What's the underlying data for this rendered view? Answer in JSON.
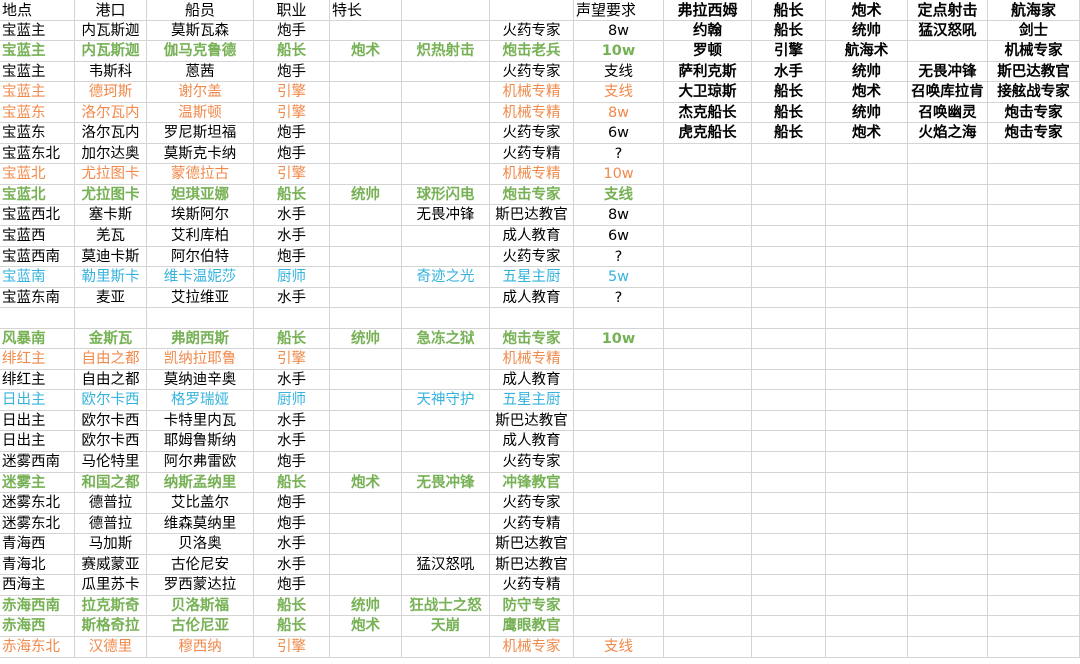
{
  "colors": {
    "green": "#77b155",
    "orange": "#f08a4b",
    "cyan": "#35b3dd",
    "grid": "#d4d4d4"
  },
  "header": [
    "地点",
    "港口",
    "船员",
    "职业",
    "特长",
    "",
    "",
    "声望要求"
  ],
  "rows": [
    {
      "style": "",
      "cells": [
        "宝蓝主",
        "内瓦斯迦",
        "莫斯瓦森",
        "炮手",
        "",
        "",
        "火药专家",
        "8w"
      ]
    },
    {
      "style": "green",
      "cells": [
        "宝蓝主",
        "内瓦斯迦",
        "伽马克鲁德",
        "船长",
        "炮术",
        "炽热射击",
        "炮击老兵",
        "10w"
      ]
    },
    {
      "style": "",
      "cells": [
        "宝蓝主",
        "韦斯科",
        "蒽茜",
        "炮手",
        "",
        "",
        "火药专家",
        "支线"
      ]
    },
    {
      "style": "orange",
      "cells": [
        "宝蓝主",
        "德珂斯",
        "谢尔盖",
        "引擎",
        "",
        "",
        "机械专精",
        "支线"
      ]
    },
    {
      "style": "orange",
      "cells": [
        "宝蓝东",
        "洛尔瓦内",
        "温斯顿",
        "引擎",
        "",
        "",
        "机械专精",
        "8w"
      ]
    },
    {
      "style": "",
      "cells": [
        "宝蓝东",
        "洛尔瓦内",
        "罗尼斯坦福",
        "炮手",
        "",
        "",
        "火药专家",
        "6w"
      ]
    },
    {
      "style": "",
      "cells": [
        "宝蓝东北",
        "加尔达奥",
        "莫斯克卡纳",
        "炮手",
        "",
        "",
        "火药专精",
        "?"
      ]
    },
    {
      "style": "orange",
      "cells": [
        "宝蓝北",
        "尤拉图卡",
        "蒙德拉古",
        "引擎",
        "",
        "",
        "机械专精",
        "10w"
      ]
    },
    {
      "style": "green",
      "cells": [
        "宝蓝北",
        "尤拉图卡",
        "妲琪亚娜",
        "船长",
        "统帅",
        "球形闪电",
        "炮击专家",
        "支线"
      ]
    },
    {
      "style": "",
      "cells": [
        "宝蓝西北",
        "塞卡斯",
        "埃斯阿尔",
        "水手",
        "",
        "无畏冲锋",
        "斯巴达教官",
        "8w"
      ]
    },
    {
      "style": "",
      "cells": [
        "宝蓝西",
        "羌瓦",
        "艾利库柏",
        "水手",
        "",
        "",
        "成人教育",
        "6w"
      ]
    },
    {
      "style": "",
      "cells": [
        "宝蓝西南",
        "莫迪卡斯",
        "阿尔伯特",
        "炮手",
        "",
        "",
        "火药专家",
        "?"
      ]
    },
    {
      "style": "cyan",
      "cells": [
        "宝蓝南",
        "勒里斯卡",
        "维卡温妮莎",
        "厨师",
        "",
        "奇迹之光",
        "五星主厨",
        "5w"
      ]
    },
    {
      "style": "",
      "cells": [
        "宝蓝东南",
        "麦亚",
        "艾拉维亚",
        "水手",
        "",
        "",
        "成人教育",
        "?"
      ]
    },
    {
      "style": "",
      "cells": [
        "",
        "",
        "",
        "",
        "",
        "",
        "",
        ""
      ]
    },
    {
      "style": "green",
      "cells": [
        "风暴南",
        "金斯瓦",
        "弗朗西斯",
        "船长",
        "统帅",
        "急冻之狱",
        "炮击专家",
        "10w"
      ]
    },
    {
      "style": "orange",
      "cells": [
        "绯红主",
        "自由之都",
        "凯纳拉耶鲁",
        "引擎",
        "",
        "",
        "机械专精",
        ""
      ]
    },
    {
      "style": "",
      "cells": [
        "绯红主",
        "自由之都",
        "莫纳迪辛奥",
        "水手",
        "",
        "",
        "成人教育",
        ""
      ]
    },
    {
      "style": "cyan",
      "cells": [
        "日出主",
        "欧尔卡西",
        "格罗瑞娅",
        "厨师",
        "",
        "天神守护",
        "五星主厨",
        ""
      ]
    },
    {
      "style": "",
      "cells": [
        "日出主",
        "欧尔卡西",
        "卡特里内瓦",
        "水手",
        "",
        "",
        "斯巴达教官",
        ""
      ]
    },
    {
      "style": "",
      "cells": [
        "日出主",
        "欧尔卡西",
        "耶姆鲁斯纳",
        "水手",
        "",
        "",
        "成人教育",
        ""
      ]
    },
    {
      "style": "",
      "cells": [
        "迷雾西南",
        "马伦特里",
        "阿尔弗雷欧",
        "炮手",
        "",
        "",
        "火药专家",
        ""
      ]
    },
    {
      "style": "green",
      "cells": [
        "迷雾主",
        "和国之都",
        "纳斯孟纳里",
        "船长",
        "炮术",
        "无畏冲锋",
        "冲锋教官",
        ""
      ]
    },
    {
      "style": "",
      "cells": [
        "迷雾东北",
        "德普拉",
        "艾比盖尔",
        "炮手",
        "",
        "",
        "火药专家",
        ""
      ]
    },
    {
      "style": "",
      "cells": [
        "迷雾东北",
        "德普拉",
        "维森莫纳里",
        "炮手",
        "",
        "",
        "火药专精",
        ""
      ]
    },
    {
      "style": "",
      "cells": [
        "青海西",
        "马加斯",
        "贝洛奥",
        "水手",
        "",
        "",
        "斯巴达教官",
        ""
      ]
    },
    {
      "style": "",
      "cells": [
        "青海北",
        "赛威蒙亚",
        "古伦尼安",
        "水手",
        "",
        "猛汉怒吼",
        "斯巴达教官",
        ""
      ]
    },
    {
      "style": "",
      "cells": [
        "西海主",
        "瓜里苏卡",
        "罗西蒙达拉",
        "炮手",
        "",
        "",
        "火药专精",
        ""
      ]
    },
    {
      "style": "green",
      "cells": [
        "赤海西南",
        "拉克斯奇",
        "贝洛斯福",
        "船长",
        "统帅",
        "狂战士之怒",
        "防守专家",
        ""
      ]
    },
    {
      "style": "green",
      "cells": [
        "赤海西",
        "斯格奇拉",
        "古伦尼亚",
        "船长",
        "炮术",
        "天崩",
        "鹰眼教官",
        ""
      ]
    },
    {
      "style": "orange",
      "cells": [
        "赤海东北",
        "汉德里",
        "穆西纳",
        "引擎",
        "",
        "",
        "机械专家",
        "支线"
      ]
    }
  ],
  "side_table": [
    [
      "弗拉西姆",
      "船长",
      "炮术",
      "定点射击",
      "航海家"
    ],
    [
      "约翰",
      "船长",
      "统帅",
      "猛汉怒吼",
      "剑士"
    ],
    [
      "罗顿",
      "引擎",
      "航海术",
      "",
      "机械专家"
    ],
    [
      "萨利克斯",
      "水手",
      "统帅",
      "无畏冲锋",
      "斯巴达教官"
    ],
    [
      "大卫琼斯",
      "船长",
      "炮术",
      "召唤库拉肯",
      "接舷战专家"
    ],
    [
      "杰克船长",
      "船长",
      "统帅",
      "召唤幽灵",
      "炮击专家"
    ],
    [
      "虎克船长",
      "船长",
      "炮术",
      "火焰之海",
      "炮击专家"
    ]
  ]
}
